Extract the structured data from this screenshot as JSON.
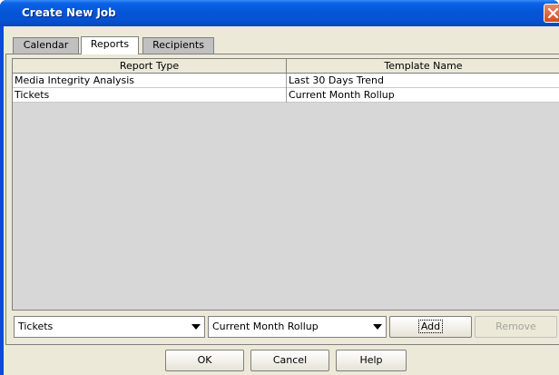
{
  "window": {
    "title": "Create New Job"
  },
  "tabs": [
    {
      "label": "Calendar"
    },
    {
      "label": "Reports"
    },
    {
      "label": "Recipients"
    }
  ],
  "table": {
    "columns": [
      "Report Type",
      "Template Name"
    ],
    "rows": [
      [
        "Media Integrity Analysis",
        "Last 30 Days Trend"
      ],
      [
        "Tickets",
        "Current Month Rollup"
      ]
    ]
  },
  "editor": {
    "report_type_value": "Tickets",
    "template_value": "Current Month Rollup",
    "add_label": "Add",
    "remove_label": "Remove"
  },
  "footer": {
    "ok_label": "OK",
    "cancel_label": "Cancel",
    "help_label": "Help"
  }
}
